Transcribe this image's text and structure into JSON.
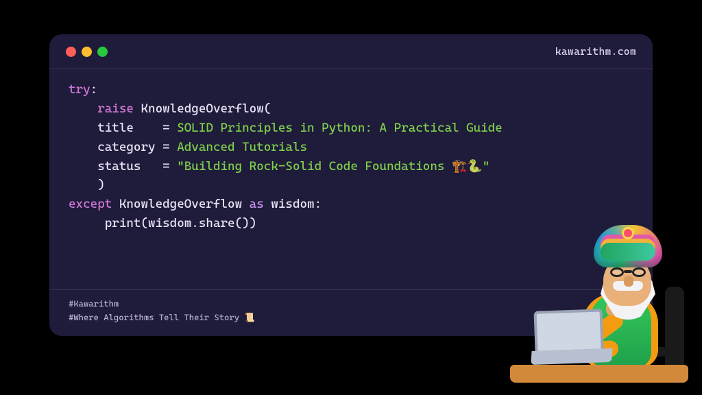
{
  "header": {
    "domain": "kawarithm.com"
  },
  "code": {
    "try": "try",
    "colon": ":",
    "raise": "raise",
    "exception": "KnowledgeOverflow",
    "open_paren": "(",
    "params": {
      "title": {
        "name": "title",
        "eq": "=",
        "value_line1": "SOLID Principles in Python: A Practical",
        "value_line2": "Guide"
      },
      "category": {
        "name": "category",
        "eq": "=",
        "value": "Advanced Tutorials"
      },
      "status": {
        "name": "status",
        "eq": "=",
        "value": "\"Building Rock-Solid Code Foundations 🏗️🐍\""
      }
    },
    "close_paren": ")",
    "except": "except",
    "as": "as",
    "alias": "wisdom",
    "body_line": "print(wisdom.share())"
  },
  "footer": {
    "tag1": "#Kawarithm",
    "tag2": "#Where Algorithms Tell Their Story 📜"
  }
}
